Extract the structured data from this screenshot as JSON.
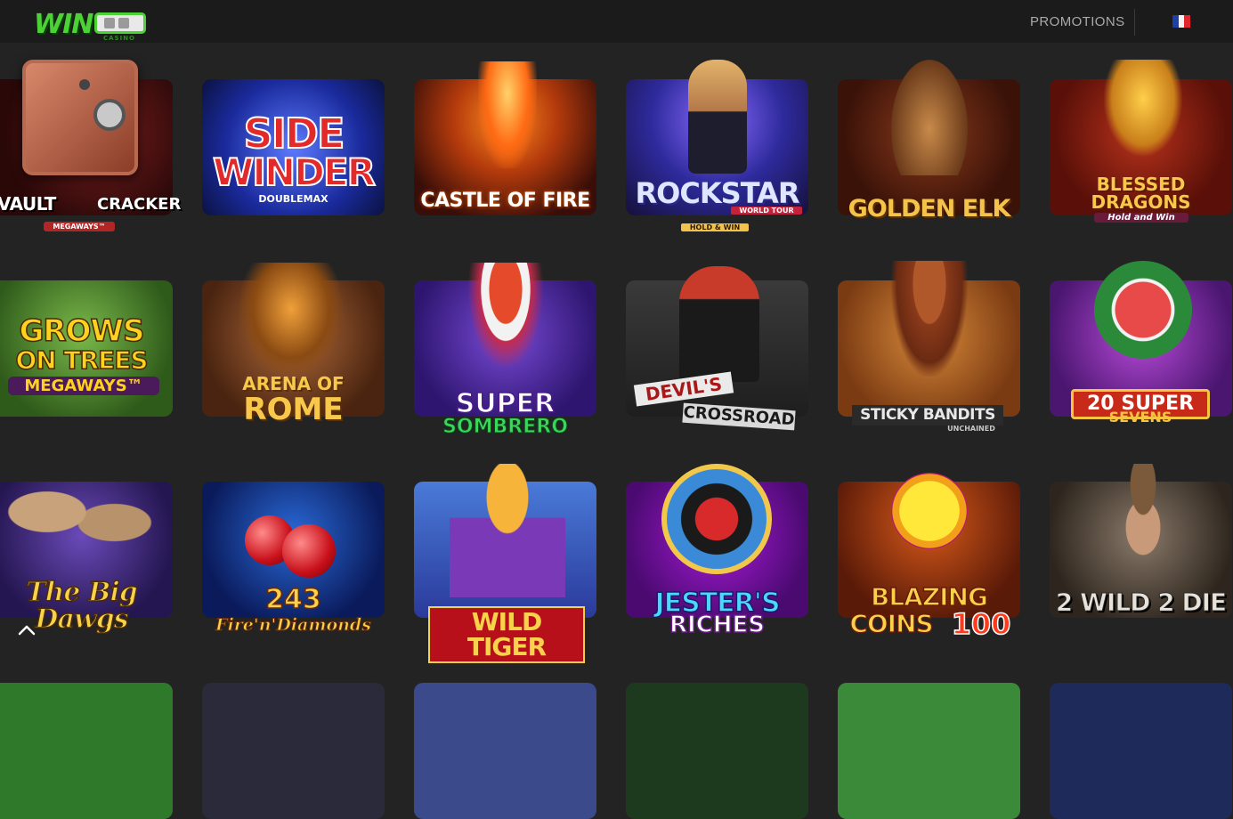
{
  "header": {
    "logo_text": "WIN",
    "logo_sub": "CASINO",
    "promotions_label": "PROMOTIONS",
    "language": "FR"
  },
  "games": [
    {
      "title": "VAULT",
      "title2": "CRACKER",
      "sub": "MEGAWAYS™"
    },
    {
      "title": "SIDE",
      "title2": "WINDER",
      "sub": "DOUBLEMAX"
    },
    {
      "title": "CASTLE OF FIRE"
    },
    {
      "title": "ROCKSTAR",
      "title2": "WORLD TOUR",
      "sub": "HOLD & WIN"
    },
    {
      "title": "GOLDEN ELK"
    },
    {
      "title": "BLESSED",
      "title2": "DRAGONS",
      "sub": "Hold and Win"
    },
    {
      "title": "GROWS",
      "title2": "ON TREES",
      "sub": "MEGAWAYS™"
    },
    {
      "title": "ARENA OF",
      "title2": "ROME"
    },
    {
      "title": "SUPER",
      "title2": "SOMBRERO"
    },
    {
      "title": "DEVIL'S",
      "title2": "CROSSROAD"
    },
    {
      "title": "STICKY BANDITS",
      "sub": "UNCHAINED"
    },
    {
      "title": "20 SUPER",
      "title2": "SEVENS"
    },
    {
      "title": "The Big Dawgs"
    },
    {
      "title": "243",
      "title2": "Fire'n'Diamonds"
    },
    {
      "title": "WILD TIGER"
    },
    {
      "title": "JESTER'S",
      "title2": "RICHES"
    },
    {
      "title": "BLAZING",
      "title2": "COINS",
      "sub": "100"
    },
    {
      "title": "2 WILD 2 DIE"
    }
  ],
  "colors": {
    "page_bg": "#232323",
    "header_bg": "#1b1b1b",
    "brand_green": "#4cd137",
    "promo_text": "#a9a9a9"
  }
}
